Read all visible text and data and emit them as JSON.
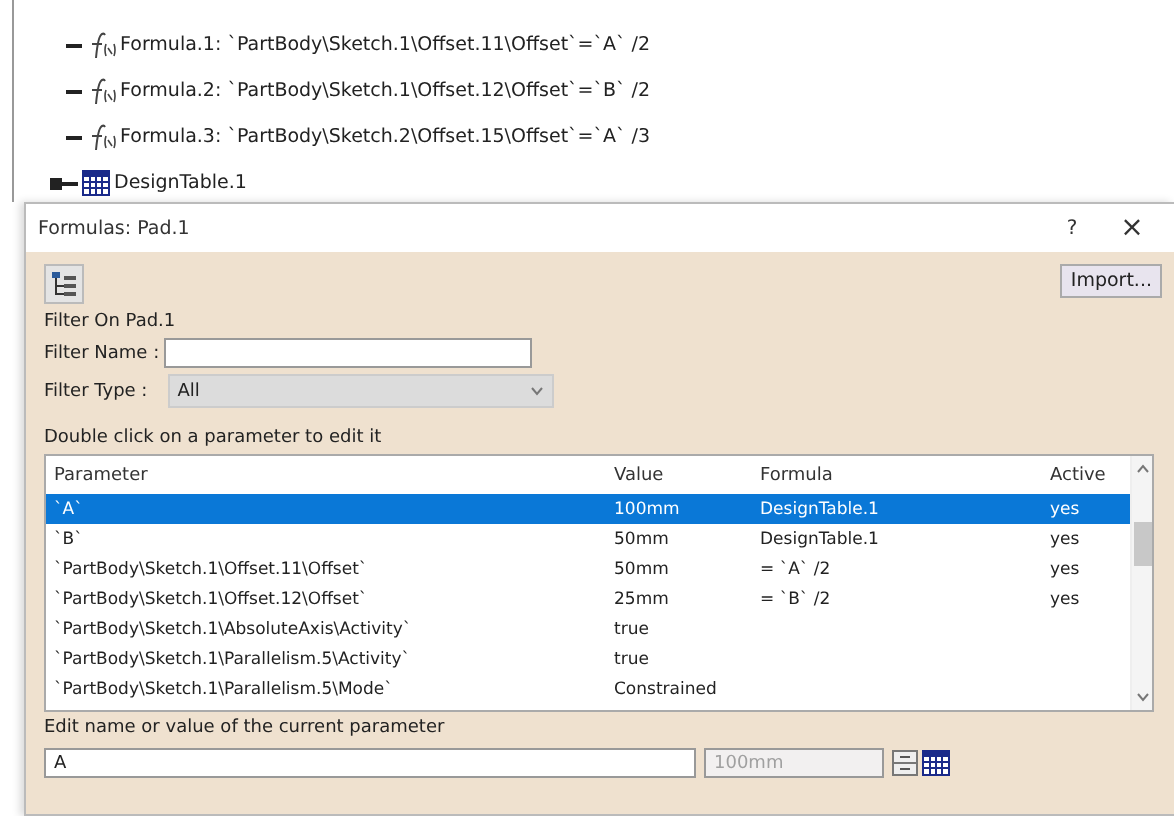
{
  "tree": {
    "items": [
      {
        "kind": "formula",
        "label": "Formula.1: `PartBody\\Sketch.1\\Offset.11\\Offset`=`A` /2"
      },
      {
        "kind": "formula",
        "label": "Formula.2: `PartBody\\Sketch.1\\Offset.12\\Offset`=`B` /2"
      },
      {
        "kind": "formula",
        "label": "Formula.3: `PartBody\\Sketch.2\\Offset.15\\Offset`=`A` /3"
      },
      {
        "kind": "table",
        "label": "DesignTable.1"
      }
    ]
  },
  "dialog": {
    "title": "Formulas: Pad.1",
    "help": "?",
    "close": "×",
    "import_button": "Import...",
    "filter_caption": "Filter On Pad.1",
    "filter_name": {
      "label": "Filter Name :"
    },
    "filter_type": {
      "label": "Filter Type :",
      "value": "All"
    },
    "hint": "Double click on a parameter to edit it",
    "table": {
      "columns": [
        "Parameter",
        "Value",
        "Formula",
        "Active"
      ],
      "rows": [
        {
          "selected": true,
          "cells": [
            "`A`",
            "100mm",
            "DesignTable.1",
            "yes"
          ]
        },
        {
          "selected": false,
          "cells": [
            "`B`",
            "50mm",
            "DesignTable.1",
            "yes"
          ]
        },
        {
          "selected": false,
          "cells": [
            "`PartBody\\Sketch.1\\Offset.11\\Offset`",
            "50mm",
            "= `A` /2",
            "yes"
          ]
        },
        {
          "selected": false,
          "cells": [
            "`PartBody\\Sketch.1\\Offset.12\\Offset`",
            "25mm",
            "= `B` /2",
            "yes"
          ]
        },
        {
          "selected": false,
          "cells": [
            "`PartBody\\Sketch.1\\AbsoluteAxis\\Activity`",
            "true",
            "",
            ""
          ]
        },
        {
          "selected": false,
          "cells": [
            "`PartBody\\Sketch.1\\Parallelism.5\\Activity`",
            "true",
            "",
            ""
          ]
        },
        {
          "selected": false,
          "cells": [
            "`PartBody\\Sketch.1\\Parallelism.5\\Mode`",
            "Constrained",
            "",
            ""
          ]
        }
      ]
    },
    "edit": {
      "label": "Edit name or value of the current parameter",
      "name_value": "A",
      "value": {
        "text": "100mm",
        "disabled": true
      }
    }
  }
}
